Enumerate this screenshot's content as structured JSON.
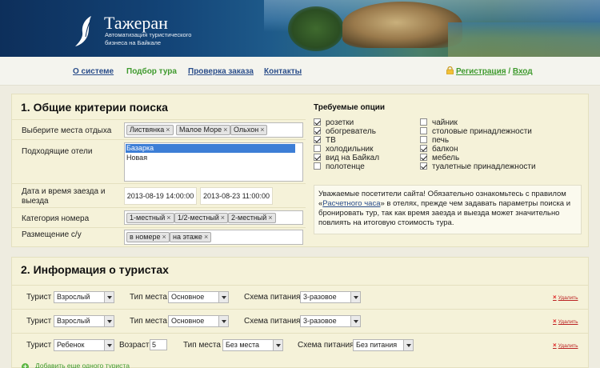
{
  "header": {
    "site_title": "Тажеран",
    "site_subtitle": "Автоматизация туристического бизнеса на Байкале"
  },
  "nav": {
    "items": [
      "О системе",
      "Подбор тура",
      "Проверка заказа",
      "Контакты"
    ],
    "active": "Подбор тура",
    "register": "Регистрация",
    "separator": " / ",
    "login": "Вход"
  },
  "section1": {
    "title": "1. Общие критерии поиска",
    "places_label": "Выберите места отдыха",
    "places": [
      "Листвянка",
      "Малое Море",
      "Ольхон"
    ],
    "hotels_label": "Подходящие отели",
    "hotels": [
      "Базарка",
      "Новая"
    ],
    "hotels_selected": "Базарка",
    "dates_label": "Дата и время заезда и выезда",
    "date_in": "2013-08-19 14:00:00",
    "date_out": "2013-08-23 11:00:00",
    "room_label": "Категория номера",
    "rooms": [
      "1-местный",
      "1/2-местный",
      "2-местный"
    ],
    "placement_label": "Размещение с/у",
    "placements": [
      "в номере",
      "на этаже"
    ],
    "tag_remove": "×"
  },
  "options": {
    "title": "Требуемые опции",
    "left": [
      {
        "label": "розетки",
        "checked": true
      },
      {
        "label": "обогреватель",
        "checked": true
      },
      {
        "label": "ТВ",
        "checked": true
      },
      {
        "label": "холодильник",
        "checked": false
      },
      {
        "label": "вид на Байкал",
        "checked": true
      },
      {
        "label": "полотенце",
        "checked": false
      }
    ],
    "right": [
      {
        "label": "чайник",
        "checked": false
      },
      {
        "label": "столовые принадлежности",
        "checked": false
      },
      {
        "label": "печь",
        "checked": false
      },
      {
        "label": "балкон",
        "checked": true
      },
      {
        "label": "мебель",
        "checked": true
      },
      {
        "label": "туалетные принадлежности",
        "checked": true
      }
    ]
  },
  "notice": {
    "before": "Уважаемые посетители сайта! Обязательно ознакомьтесь с правилом «",
    "link": "Расчетного часа",
    "after": "» в отелях, прежде чем задавать параметры поиска и бронировать тур, так как время заезда и выезда может значительно повлиять на итоговую стоимость тура."
  },
  "section2": {
    "title": "2. Информация о туристах",
    "tourist_label": "Турист",
    "place_type_label": "Тип места",
    "meal_label": "Схема питания",
    "age_label": "Возраст:",
    "delete_label": "Удалить",
    "delete_icon": "×",
    "rows": [
      {
        "tourist": "Взрослый",
        "place_type": "Основное",
        "meal": "3-разовое"
      },
      {
        "tourist": "Взрослый",
        "place_type": "Основное",
        "meal": "3-разовое"
      },
      {
        "tourist": "Ребенок",
        "age": "5",
        "place_type": "Без места",
        "meal": "Без питания"
      }
    ],
    "add_label": "Добавить еще одного туриста",
    "add_icon": "+"
  },
  "colors": {
    "link": "#2a4d8a",
    "green": "#3f9a2e",
    "panel": "#f5f2d9",
    "selection": "#3d7ed6",
    "delete": "#b22222"
  },
  "icons": {
    "logo": "baikal-logo-icon",
    "lock": "lock-icon",
    "checkbox": "checkbox-icon",
    "select_arrow": "chevron-down-icon",
    "delete": "close-icon",
    "add": "plus-circle-icon"
  }
}
